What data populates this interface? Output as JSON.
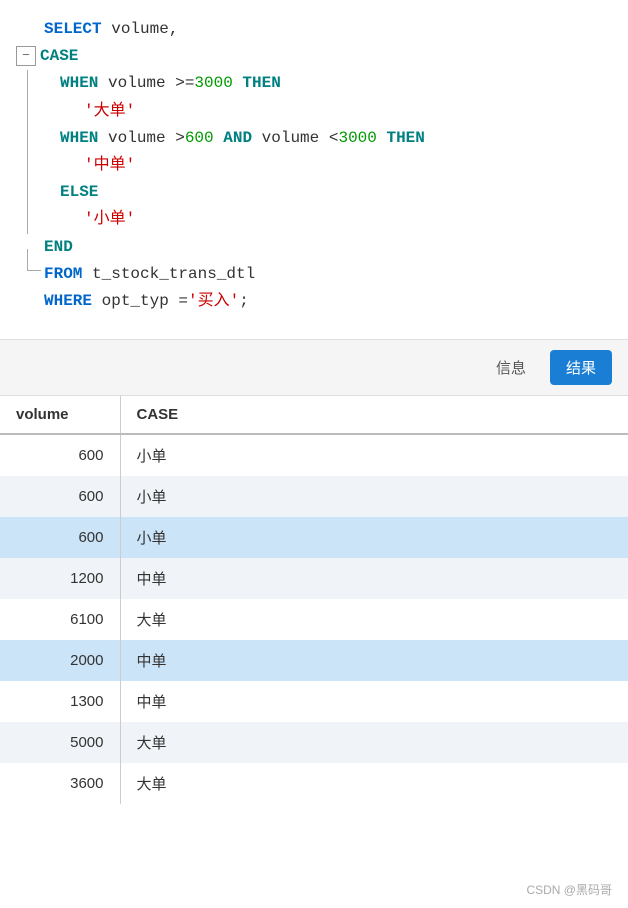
{
  "code": {
    "line1": {
      "keyword": "SELECT",
      "rest": " volume,"
    },
    "line2": {
      "keyword": "CASE"
    },
    "line3": {
      "keyword": "WHEN",
      "rest": " volume >= ",
      "num1": "3000",
      "kw2": " THEN"
    },
    "line4": {
      "str": "'大单'"
    },
    "line5": {
      "keyword": "WHEN",
      "rest": " volume > ",
      "num1": "600",
      "kw2": " AND",
      "rest2": " volume < ",
      "num2": "3000",
      "kw3": " THEN"
    },
    "line6": {
      "str": "'中单'"
    },
    "line7": {
      "keyword": "ELSE"
    },
    "line8": {
      "str": "'小单'"
    },
    "line9": {
      "keyword": "END"
    },
    "line10": {
      "keyword": "FROM",
      "rest": " t_stock_trans_dtl"
    },
    "line11": {
      "keyword": "WHERE",
      "rest": " opt_typ = ",
      "str": "'买入'",
      "semi": ";"
    }
  },
  "toolbar": {
    "info_label": "信息",
    "result_label": "结果"
  },
  "table": {
    "col1": "volume",
    "col2": "CASE",
    "rows": [
      {
        "volume": "600",
        "case": "小单",
        "highlight": false
      },
      {
        "volume": "600",
        "case": "小单",
        "highlight": false
      },
      {
        "volume": "600",
        "case": "小单",
        "highlight": true
      },
      {
        "volume": "1200",
        "case": "中单",
        "highlight": false
      },
      {
        "volume": "6100",
        "case": "大单",
        "highlight": false
      },
      {
        "volume": "2000",
        "case": "中单",
        "highlight": true
      },
      {
        "volume": "1300",
        "case": "中单",
        "highlight": false
      },
      {
        "volume": "5000",
        "case": "大单",
        "highlight": false
      },
      {
        "volume": "3600",
        "case": "大单",
        "highlight": false
      }
    ]
  },
  "watermark": "CSDN @黑码哥"
}
